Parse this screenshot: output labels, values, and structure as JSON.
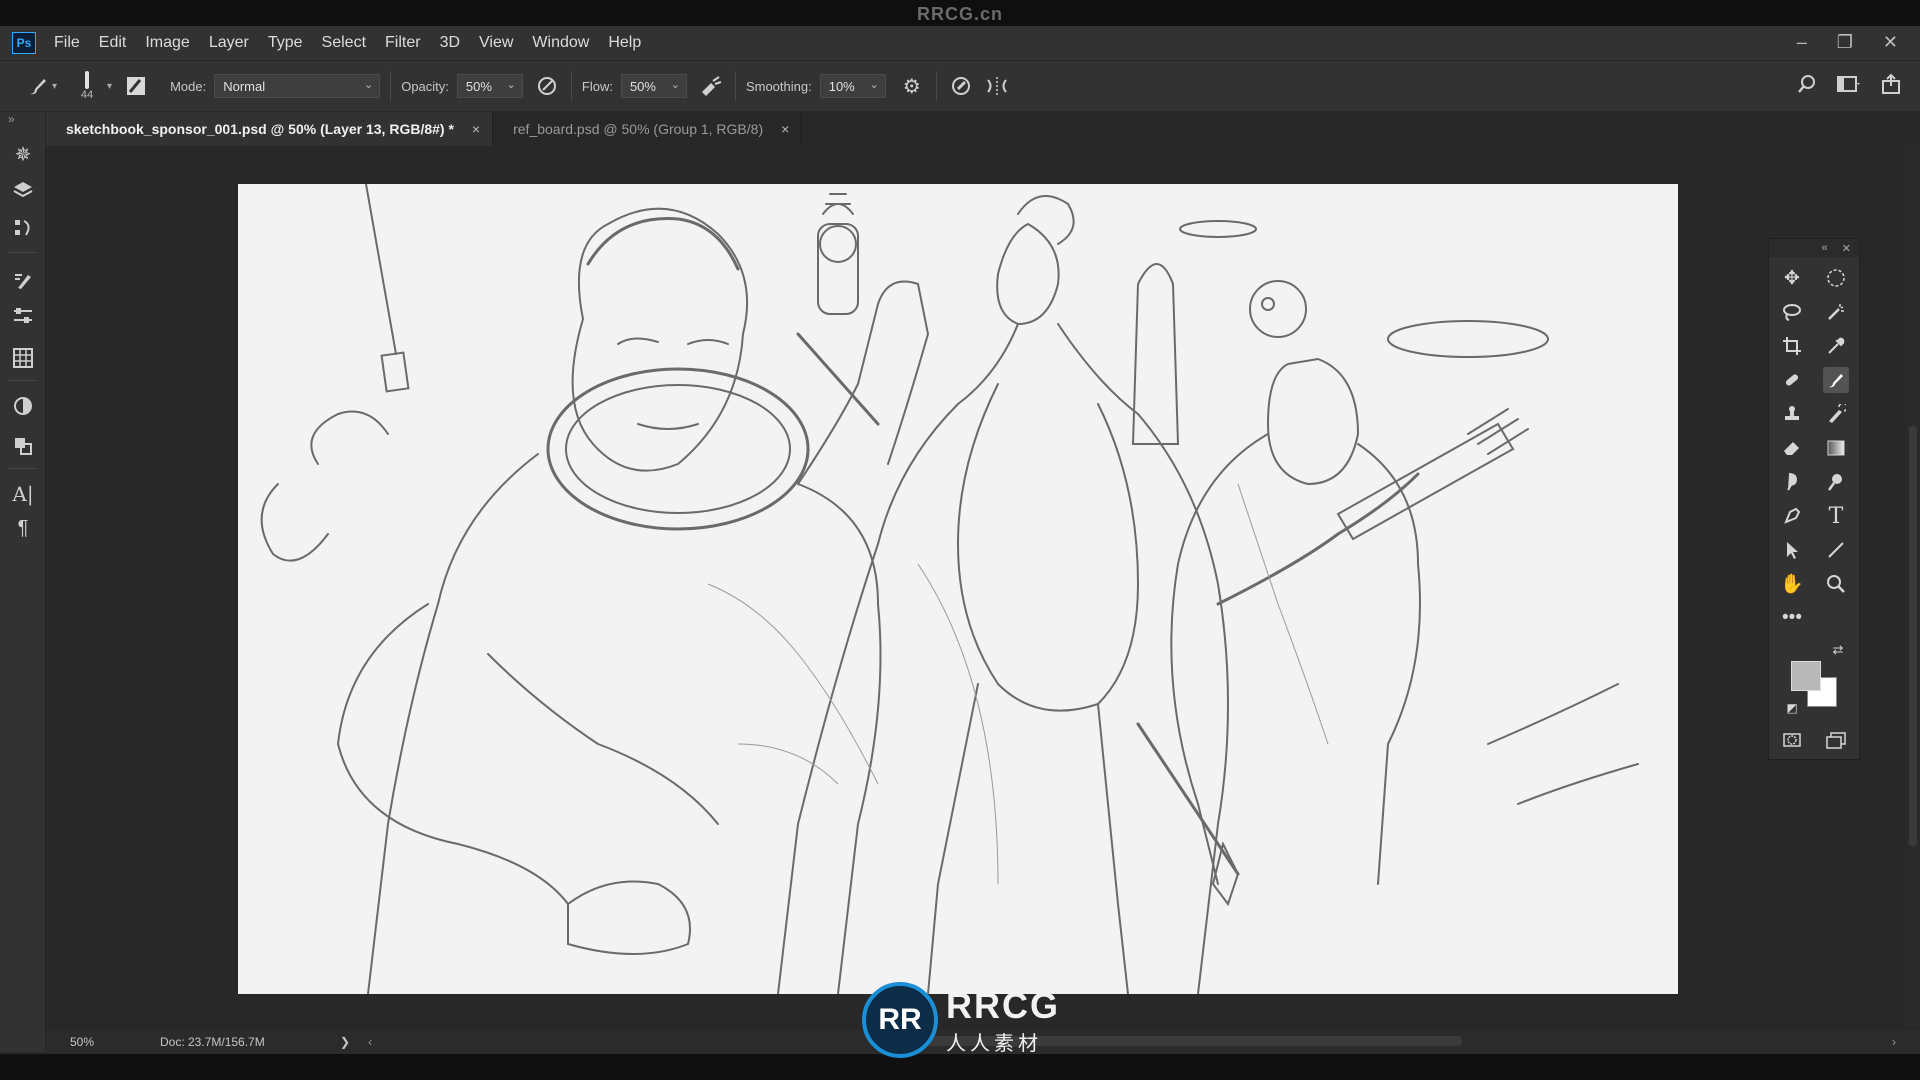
{
  "watermark": {
    "top_text": "RRCG.cn",
    "logo_text": "RRCG",
    "logo_sub": "人人素材",
    "logo_mark": "RR"
  },
  "app": {
    "logo": "Ps"
  },
  "menu": [
    "File",
    "Edit",
    "Image",
    "Layer",
    "Type",
    "Select",
    "Filter",
    "3D",
    "View",
    "Window",
    "Help"
  ],
  "window_controls": {
    "minimize": "–",
    "restore": "❐",
    "close": "✕"
  },
  "options": {
    "brush_size": "44",
    "mode_label": "Mode:",
    "mode_value": "Normal",
    "opacity_label": "Opacity:",
    "opacity_value": "50%",
    "flow_label": "Flow:",
    "flow_value": "50%",
    "smoothing_label": "Smoothing:",
    "smoothing_value": "10%"
  },
  "tabs": [
    {
      "label": "sketchbook_sponsor_001.psd @ 50% (Layer 13, RGB/8#) *",
      "close": "×",
      "active": true
    },
    {
      "label": "ref_board.psd @ 50% (Group 1, RGB/8)",
      "close": "×",
      "active": false
    }
  ],
  "status": {
    "zoom": "50%",
    "doc": "Doc: 23.7M/156.7M",
    "arrow": "❯"
  },
  "colors": {
    "foreground": "#b8b8b8",
    "background": "#ffffff",
    "accent": "#31a8ff"
  },
  "toolbar_left_icons": [
    "brush-settings-icon",
    "layers-icon",
    "paths-icon",
    "brush-icon",
    "adjust-icon",
    "grid-icon",
    "color-icon",
    "3d-icon",
    "character-icon",
    "paragraph-icon"
  ],
  "tool_panel_icons": [
    "move-icon",
    "ellipse-marquee-icon",
    "lasso-icon",
    "magic-wand-icon",
    "crop-icon",
    "eyedropper-icon",
    "healing-icon",
    "brush-tool-icon",
    "stamp-icon",
    "history-brush-icon",
    "eraser-icon",
    "gradient-icon",
    "smudge-icon",
    "dodge-icon",
    "pen-icon",
    "type-tool-icon",
    "path-select-icon",
    "line-icon",
    "hand-icon",
    "zoom-icon",
    "more-tools-icon"
  ]
}
